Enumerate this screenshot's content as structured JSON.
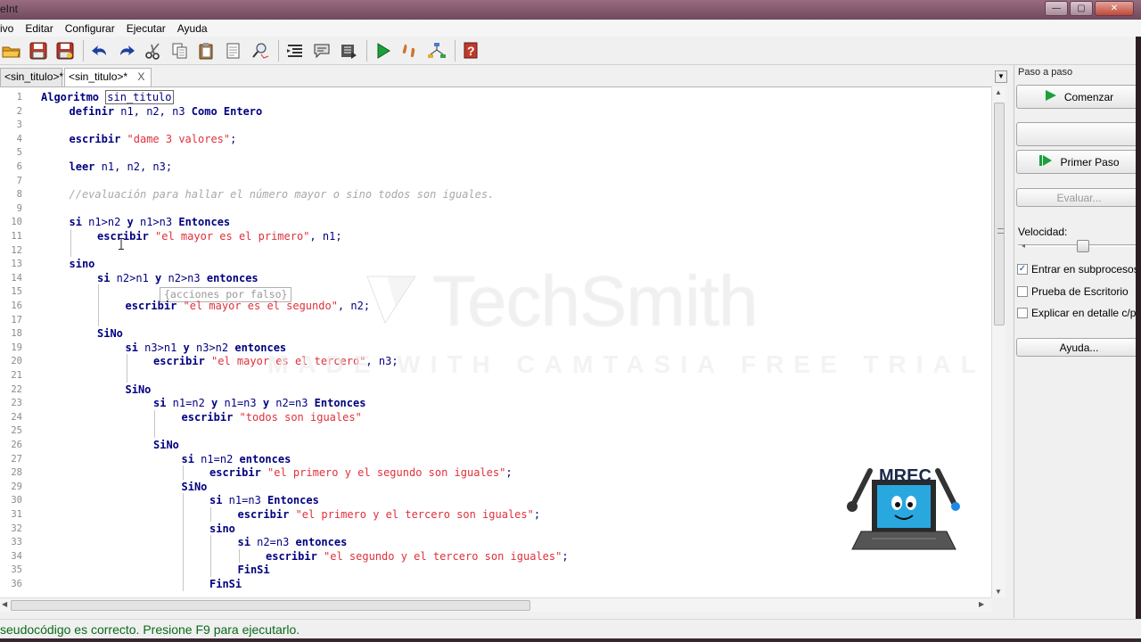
{
  "window": {
    "title": "eInt",
    "buttons": {
      "minimize": "—",
      "maximize": "▢",
      "close": "✕"
    }
  },
  "menu": [
    "ivo",
    "Editar",
    "Configurar",
    "Ejecutar",
    "Ayuda"
  ],
  "toolbar": {
    "icons": [
      "open-icon",
      "save-icon",
      "save-as-icon",
      "undo-icon",
      "redo-icon",
      "cut-icon",
      "copy-icon",
      "paste-icon",
      "delete-icon",
      "find-icon",
      "indent-icon",
      "comment-icon",
      "execute-icon",
      "run-icon",
      "step-icon",
      "flowchart-icon",
      "help-icon"
    ]
  },
  "tabs": [
    {
      "label": "<sin_titulo>*",
      "active": false
    },
    {
      "label": "<sin_titulo>*",
      "active": true,
      "close": "X"
    }
  ],
  "editor": {
    "hint": "{acciones por falso}",
    "lines": [
      {
        "n": "1",
        "indent": 0,
        "parts": [
          [
            "kw",
            "Algoritmo "
          ],
          [
            "box",
            "sin_titulo"
          ]
        ]
      },
      {
        "n": "2",
        "indent": 1,
        "parts": [
          [
            "kw",
            "definir"
          ],
          [
            "t",
            " n1, n2, n3 "
          ],
          [
            "kw",
            "Como Entero"
          ]
        ]
      },
      {
        "n": "3",
        "indent": 0,
        "parts": []
      },
      {
        "n": "4",
        "indent": 1,
        "parts": [
          [
            "kw",
            "escribir "
          ],
          [
            "str",
            "\"dame 3 valores\""
          ],
          [
            "t",
            ";"
          ]
        ]
      },
      {
        "n": "5",
        "indent": 0,
        "parts": []
      },
      {
        "n": "6",
        "indent": 1,
        "parts": [
          [
            "kw",
            "leer"
          ],
          [
            "t",
            " n1, n2, n3;"
          ]
        ]
      },
      {
        "n": "7",
        "indent": 0,
        "parts": []
      },
      {
        "n": "8",
        "indent": 1,
        "parts": [
          [
            "cmt",
            "//evaluación para hallar el número mayor o sino todos son iguales."
          ]
        ]
      },
      {
        "n": "9",
        "indent": 0,
        "parts": []
      },
      {
        "n": "10",
        "indent": 1,
        "parts": [
          [
            "kw",
            "si"
          ],
          [
            "t",
            " n1>n2 "
          ],
          [
            "kw",
            "y"
          ],
          [
            "t",
            " n1>n3 "
          ],
          [
            "kw",
            "Entonces"
          ]
        ]
      },
      {
        "n": "11",
        "indent": 2,
        "parts": [
          [
            "kw",
            "escribir "
          ],
          [
            "str",
            "\"el mayor es el primero\""
          ],
          [
            "t",
            ", n1;"
          ]
        ]
      },
      {
        "n": "12",
        "indent": 0,
        "parts": []
      },
      {
        "n": "13",
        "indent": 1,
        "parts": [
          [
            "kw",
            "sino"
          ]
        ]
      },
      {
        "n": "14",
        "indent": 2,
        "parts": [
          [
            "kw",
            "si"
          ],
          [
            "t",
            " n2>n1 "
          ],
          [
            "kw",
            "y"
          ],
          [
            "t",
            " n2>n3 "
          ],
          [
            "kw",
            "entonces"
          ]
        ]
      },
      {
        "n": "15",
        "indent": 0,
        "parts": []
      },
      {
        "n": "16",
        "indent": 3,
        "parts": [
          [
            "kw",
            "escribir "
          ],
          [
            "str",
            "\"el mayor es el segundo\""
          ],
          [
            "t",
            ", n2;"
          ]
        ]
      },
      {
        "n": "17",
        "indent": 0,
        "parts": []
      },
      {
        "n": "18",
        "indent": 2,
        "parts": [
          [
            "kw",
            "SiNo"
          ]
        ]
      },
      {
        "n": "19",
        "indent": 3,
        "parts": [
          [
            "kw",
            "si"
          ],
          [
            "t",
            " n3>n1 "
          ],
          [
            "kw",
            "y"
          ],
          [
            "t",
            " n3>n2 "
          ],
          [
            "kw",
            "entonces"
          ]
        ]
      },
      {
        "n": "20",
        "indent": 4,
        "parts": [
          [
            "kw",
            "escribir "
          ],
          [
            "str",
            "\"el mayor es el tercero\""
          ],
          [
            "t",
            ", n3;"
          ]
        ]
      },
      {
        "n": "21",
        "indent": 0,
        "parts": []
      },
      {
        "n": "22",
        "indent": 3,
        "parts": [
          [
            "kw",
            "SiNo"
          ]
        ]
      },
      {
        "n": "23",
        "indent": 4,
        "parts": [
          [
            "kw",
            "si"
          ],
          [
            "t",
            " n1=n2 "
          ],
          [
            "kw",
            "y"
          ],
          [
            "t",
            " n1=n3 "
          ],
          [
            "kw",
            "y"
          ],
          [
            "t",
            " n2=n3 "
          ],
          [
            "kw",
            "Entonces"
          ]
        ]
      },
      {
        "n": "24",
        "indent": 5,
        "parts": [
          [
            "kw",
            "escribir "
          ],
          [
            "str",
            "\"todos son iguales\""
          ]
        ]
      },
      {
        "n": "25",
        "indent": 0,
        "parts": []
      },
      {
        "n": "26",
        "indent": 4,
        "parts": [
          [
            "kw",
            "SiNo"
          ]
        ]
      },
      {
        "n": "27",
        "indent": 5,
        "parts": [
          [
            "kw",
            "si"
          ],
          [
            "t",
            " n1=n2 "
          ],
          [
            "kw",
            "entonces"
          ]
        ]
      },
      {
        "n": "28",
        "indent": 6,
        "parts": [
          [
            "kw",
            "escribir "
          ],
          [
            "str",
            "\"el primero y el segundo son iguales\""
          ],
          [
            "t",
            ";"
          ]
        ]
      },
      {
        "n": "29",
        "indent": 5,
        "parts": [
          [
            "kw",
            "SiNo"
          ]
        ]
      },
      {
        "n": "30",
        "indent": 6,
        "parts": [
          [
            "kw",
            "si"
          ],
          [
            "t",
            " n1=n3 "
          ],
          [
            "kw",
            "Entonces"
          ]
        ]
      },
      {
        "n": "31",
        "indent": 7,
        "parts": [
          [
            "kw",
            "escribir "
          ],
          [
            "str",
            "\"el primero y el tercero son iguales\""
          ],
          [
            "t",
            ";"
          ]
        ]
      },
      {
        "n": "32",
        "indent": 6,
        "parts": [
          [
            "kw",
            "sino"
          ]
        ]
      },
      {
        "n": "33",
        "indent": 7,
        "parts": [
          [
            "kw",
            "si"
          ],
          [
            "t",
            " n2=n3 "
          ],
          [
            "kw",
            "entonces"
          ]
        ]
      },
      {
        "n": "34",
        "indent": 8,
        "parts": [
          [
            "kw",
            "escribir "
          ],
          [
            "str",
            "\"el segundo y el tercero son iguales\""
          ],
          [
            "t",
            ";"
          ]
        ]
      },
      {
        "n": "35",
        "indent": 7,
        "parts": [
          [
            "kw",
            "FinSi"
          ]
        ]
      },
      {
        "n": "36",
        "indent": 6,
        "parts": [
          [
            "kw",
            "FinSi"
          ]
        ]
      }
    ]
  },
  "panel": {
    "title": "Paso a paso",
    "comenzar": "Comenzar",
    "primer_paso": "Primer Paso",
    "evaluar": "Evaluar...",
    "velocidad": "Velocidad:",
    "checks": [
      {
        "label": "Entrar en subprocesos",
        "checked": true
      },
      {
        "label": "Prueba de Escritorio",
        "checked": false
      },
      {
        "label": "Explicar en detalle c/pa",
        "checked": false
      }
    ],
    "ayuda": "Ayuda..."
  },
  "status": "seudocódigo es correcto. Presione F9 para ejecutarlo.",
  "watermark": {
    "brand": "TechSmith",
    "sub": "MADE WITH CAMTASIA FREE TRIAL"
  },
  "mascot": {
    "label": "MREC"
  },
  "colors": {
    "keyword": "#000080",
    "string": "#e0303a",
    "comment": "#a8a8a8",
    "status": "#0a6a1a",
    "run_green": "#1ba03a"
  }
}
